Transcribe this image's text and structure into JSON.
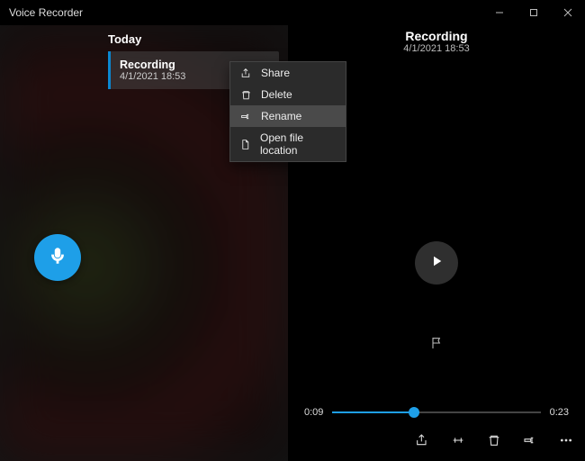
{
  "app_title": "Voice Recorder",
  "sidebar": {
    "section_label": "Today",
    "items": [
      {
        "title": "Recording",
        "subtitle": "4/1/2021 18:53"
      }
    ]
  },
  "context_menu": {
    "items": [
      {
        "label": "Share"
      },
      {
        "label": "Delete"
      },
      {
        "label": "Rename"
      },
      {
        "label": "Open file location"
      }
    ]
  },
  "detail": {
    "title": "Recording",
    "subtitle": "4/1/2021 18:53"
  },
  "timeline": {
    "current": "0:09",
    "total": "0:23",
    "progress_pct": 39
  },
  "colors": {
    "accent": "#1e9fe8"
  }
}
